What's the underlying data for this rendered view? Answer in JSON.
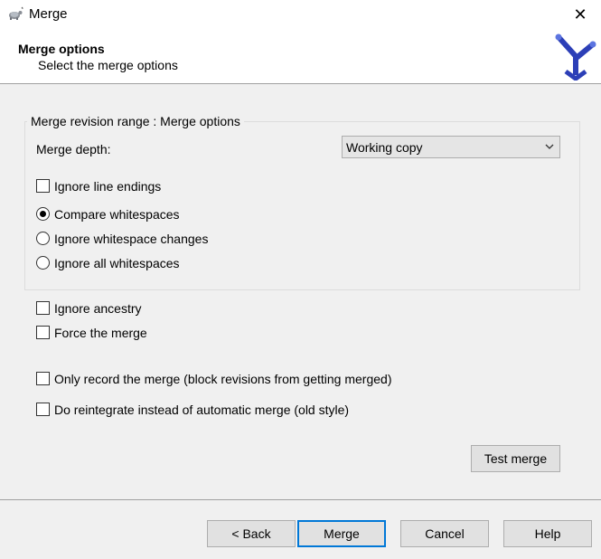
{
  "window": {
    "title": "Merge",
    "close_glyph": "✕",
    "app_icon": "tortoise-icon"
  },
  "header": {
    "title": "Merge options",
    "subtitle": "Select the merge options",
    "logo_icon": "merge-logo-icon"
  },
  "group": {
    "legend": "Merge revision range : Merge options",
    "depth_label": "Merge depth:",
    "depth_value": "Working copy",
    "ignore_line_endings": {
      "label": "Ignore line endings",
      "checked": false
    },
    "whitespace_options": [
      {
        "label": "Compare whitespaces",
        "selected": true
      },
      {
        "label": "Ignore whitespace changes",
        "selected": false
      },
      {
        "label": "Ignore all whitespaces",
        "selected": false
      }
    ]
  },
  "options": {
    "ignore_ancestry": {
      "label": "Ignore ancestry",
      "checked": false
    },
    "force_merge": {
      "label": "Force the merge",
      "checked": false
    },
    "only_record": {
      "label": "Only record the merge (block revisions from getting merged)",
      "checked": false
    },
    "reintegrate": {
      "label": "Do reintegrate instead of automatic merge (old style)",
      "checked": false
    }
  },
  "buttons": {
    "test_merge": "Test merge",
    "back": "< Back",
    "merge": "Merge",
    "cancel": "Cancel",
    "help": "Help"
  },
  "colors": {
    "accent": "#0078d7",
    "logo": "#2c3fb7"
  }
}
